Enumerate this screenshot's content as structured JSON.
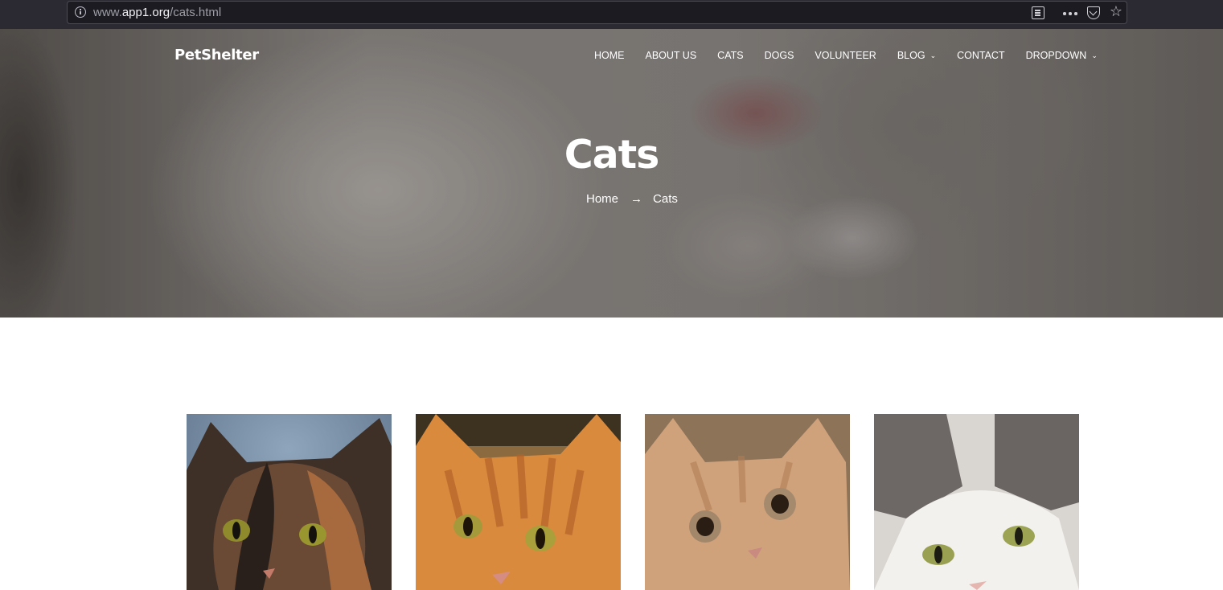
{
  "browser": {
    "url_prefix": "www.",
    "url_host": "app1.org",
    "url_path": "/cats.html",
    "icons": [
      "info-icon",
      "reader-view-icon",
      "more-icon",
      "pocket-icon",
      "bookmark-star-icon"
    ]
  },
  "site": {
    "logo": "PetShelter"
  },
  "nav": {
    "items": [
      {
        "label": "HOME",
        "dropdown": false
      },
      {
        "label": "ABOUT US",
        "dropdown": false
      },
      {
        "label": "CATS",
        "dropdown": false
      },
      {
        "label": "DOGS",
        "dropdown": false
      },
      {
        "label": "VOLUNTEER",
        "dropdown": false
      },
      {
        "label": "BLOG",
        "dropdown": true
      },
      {
        "label": "CONTACT",
        "dropdown": false
      },
      {
        "label": "DROPDOWN",
        "dropdown": true
      }
    ]
  },
  "hero": {
    "title": "Cats",
    "breadcrumb": {
      "home": "Home",
      "arrow": "→",
      "current": "Cats"
    }
  },
  "cards": [
    {
      "name": "tortoiseshell-cat-photo"
    },
    {
      "name": "orange-tabby-cat-photo"
    },
    {
      "name": "ginger-kitten-photo"
    },
    {
      "name": "grey-white-cat-photo"
    }
  ],
  "colors": {
    "browser_bar": "#2b2a33",
    "url_box": "#1c1b22",
    "text_white": "#ffffff"
  }
}
